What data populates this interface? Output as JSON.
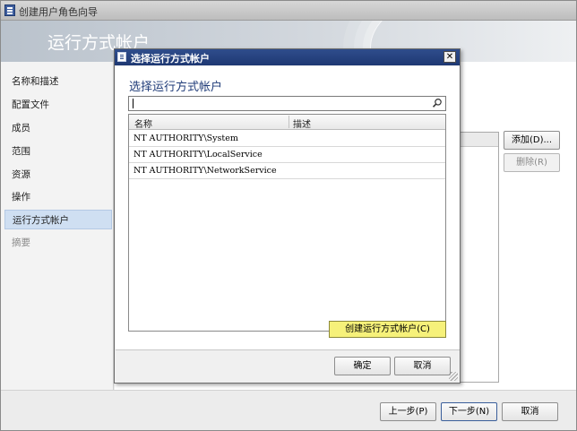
{
  "window": {
    "title": "创建用户角色向导"
  },
  "banner": {
    "title": "运行方式帐户"
  },
  "nav": {
    "items": [
      {
        "label": "名称和描述"
      },
      {
        "label": "配置文件"
      },
      {
        "label": "成员"
      },
      {
        "label": "范围"
      },
      {
        "label": "资源"
      },
      {
        "label": "操作"
      },
      {
        "label": "运行方式帐户"
      },
      {
        "label": "摘要"
      }
    ],
    "active": "运行方式帐户"
  },
  "side_buttons": {
    "add": "添加(D)...",
    "remove": "删除(R)"
  },
  "footer_buttons": {
    "prev": "上一步(P)",
    "next": "下一步(N)",
    "cancel": "取消"
  },
  "dialog": {
    "title": "选择运行方式帐户",
    "heading": "选择运行方式帐户",
    "search": {
      "value": "",
      "placeholder": ""
    },
    "columns": [
      "名称",
      "描述"
    ],
    "rows": [
      {
        "name": "NT AUTHORITY\\System",
        "description": ""
      },
      {
        "name": "NT AUTHORITY\\LocalService",
        "description": ""
      },
      {
        "name": "NT AUTHORITY\\NetworkService",
        "description": ""
      }
    ],
    "create_button": "创建运行方式帐户(C)",
    "ok_button": "确定",
    "cancel_button": "取消",
    "close_glyph": "✕"
  },
  "colors": {
    "accent": "#1f3b78",
    "create_button_bg": "#f6f17a",
    "nav_active_bg": "#cfdff2"
  }
}
